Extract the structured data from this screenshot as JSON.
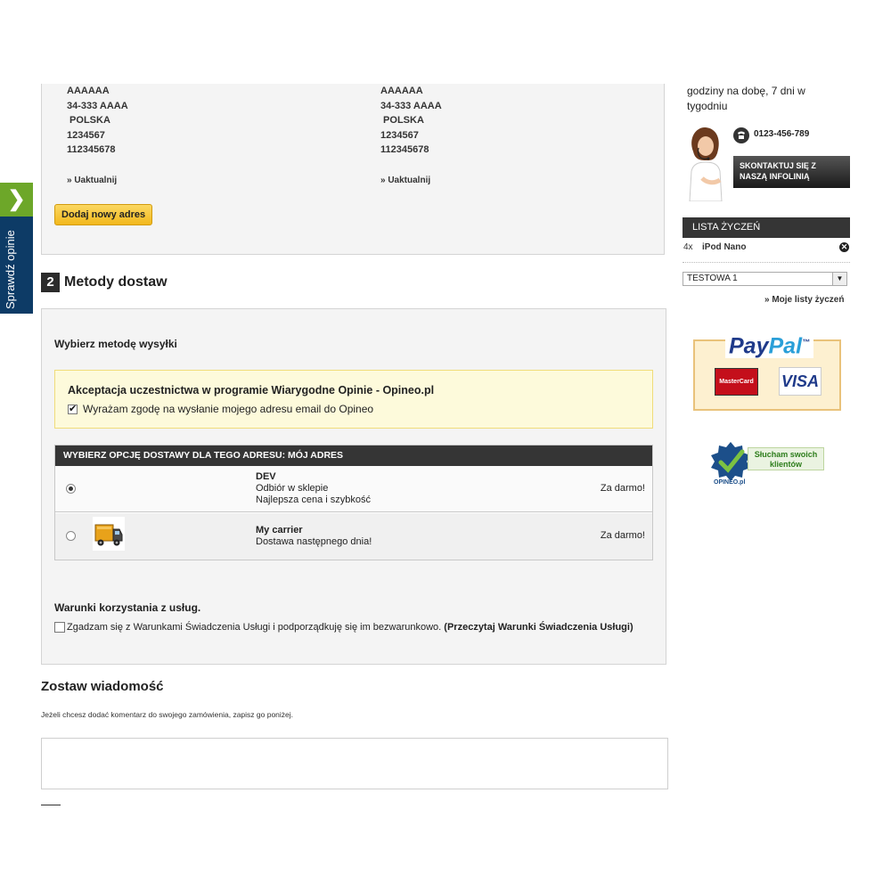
{
  "addresses": [
    {
      "lines": [
        "AAAAAA",
        "34-333 AAAA",
        " POLSKA",
        "1234567",
        "112345678"
      ],
      "update_link": "» Uaktualnij"
    },
    {
      "lines": [
        "AAAAAA",
        "34-333 AAAA",
        " POLSKA",
        "1234567",
        "112345678"
      ],
      "update_link": "» Uaktualnij"
    }
  ],
  "add_address_button": "Dodaj nowy adres",
  "section": {
    "number": "2",
    "title": "Metody dostaw"
  },
  "delivery": {
    "choose_label": "Wybierz metodę wysyłki",
    "opineo": {
      "title": "Akceptacja uczestnictwa w programie Wiarygodne Opinie - Opineo.pl",
      "consent": "Wyrażam zgodę na wysłanie mojego adresu email do Opineo",
      "checked": true
    },
    "carrier_header": "WYBIERZ OPCJĘ DOSTAWY DLA TEGO ADRESU: MÓJ ADRES",
    "carriers": [
      {
        "name": "DEV",
        "line1": "Odbiór w sklepie",
        "line2": "Najlepsza cena i szybkość",
        "price": "Za darmo!",
        "selected": true,
        "icon": "none"
      },
      {
        "name": "My carrier",
        "line1": "Dostawa następnego dnia!",
        "line2": "",
        "price": "Za darmo!",
        "selected": false,
        "icon": "truck-icon"
      }
    ],
    "terms_title": "Warunki korzystania z usług.",
    "terms_text": "Zgadzam się z Warunkami Świadczenia Usługi i podporządkuję się im bezwarunkowo.",
    "terms_link": "(Przeczytaj Warunki Świadczenia Usługi)"
  },
  "message": {
    "title": "Zostaw wiadomość",
    "description": "Jeżeli chcesz dodać komentarz do swojego zamówienia, zapisz go poniżej.",
    "value": ""
  },
  "opinie_tab": {
    "label": "Sprawdź opinie",
    "arrow": "❯"
  },
  "sidebar": {
    "hours": "godziny na dobę, 7 dni w tygodniu",
    "phone": "0123-456-789",
    "contact_button": "SKONTAKTUJ SIĘ Z NASZĄ INFOLINIĄ",
    "wishlist": {
      "header": "LISTA ŻYCZEŃ",
      "item_qty": "4x",
      "item_name": "iPod Nano",
      "remove_icon": "✕",
      "selected_list": "TESTOWA 1",
      "my_lists_link": "» Moje listy życzeń"
    },
    "paypal": {
      "brand_pay": "Pay",
      "brand_pal": "Pal",
      "tm": "™",
      "mastercard": "MasterCard",
      "visa": "VISA"
    },
    "opineo_badge": {
      "text": "Słucham swoich klientów",
      "brand": "OPINEO.pl"
    }
  },
  "colors": {
    "accent_button": "#f2b81c",
    "dark_header": "#353535",
    "opinie_tab": "#0d3b66",
    "opinie_arrow": "#6da729"
  }
}
